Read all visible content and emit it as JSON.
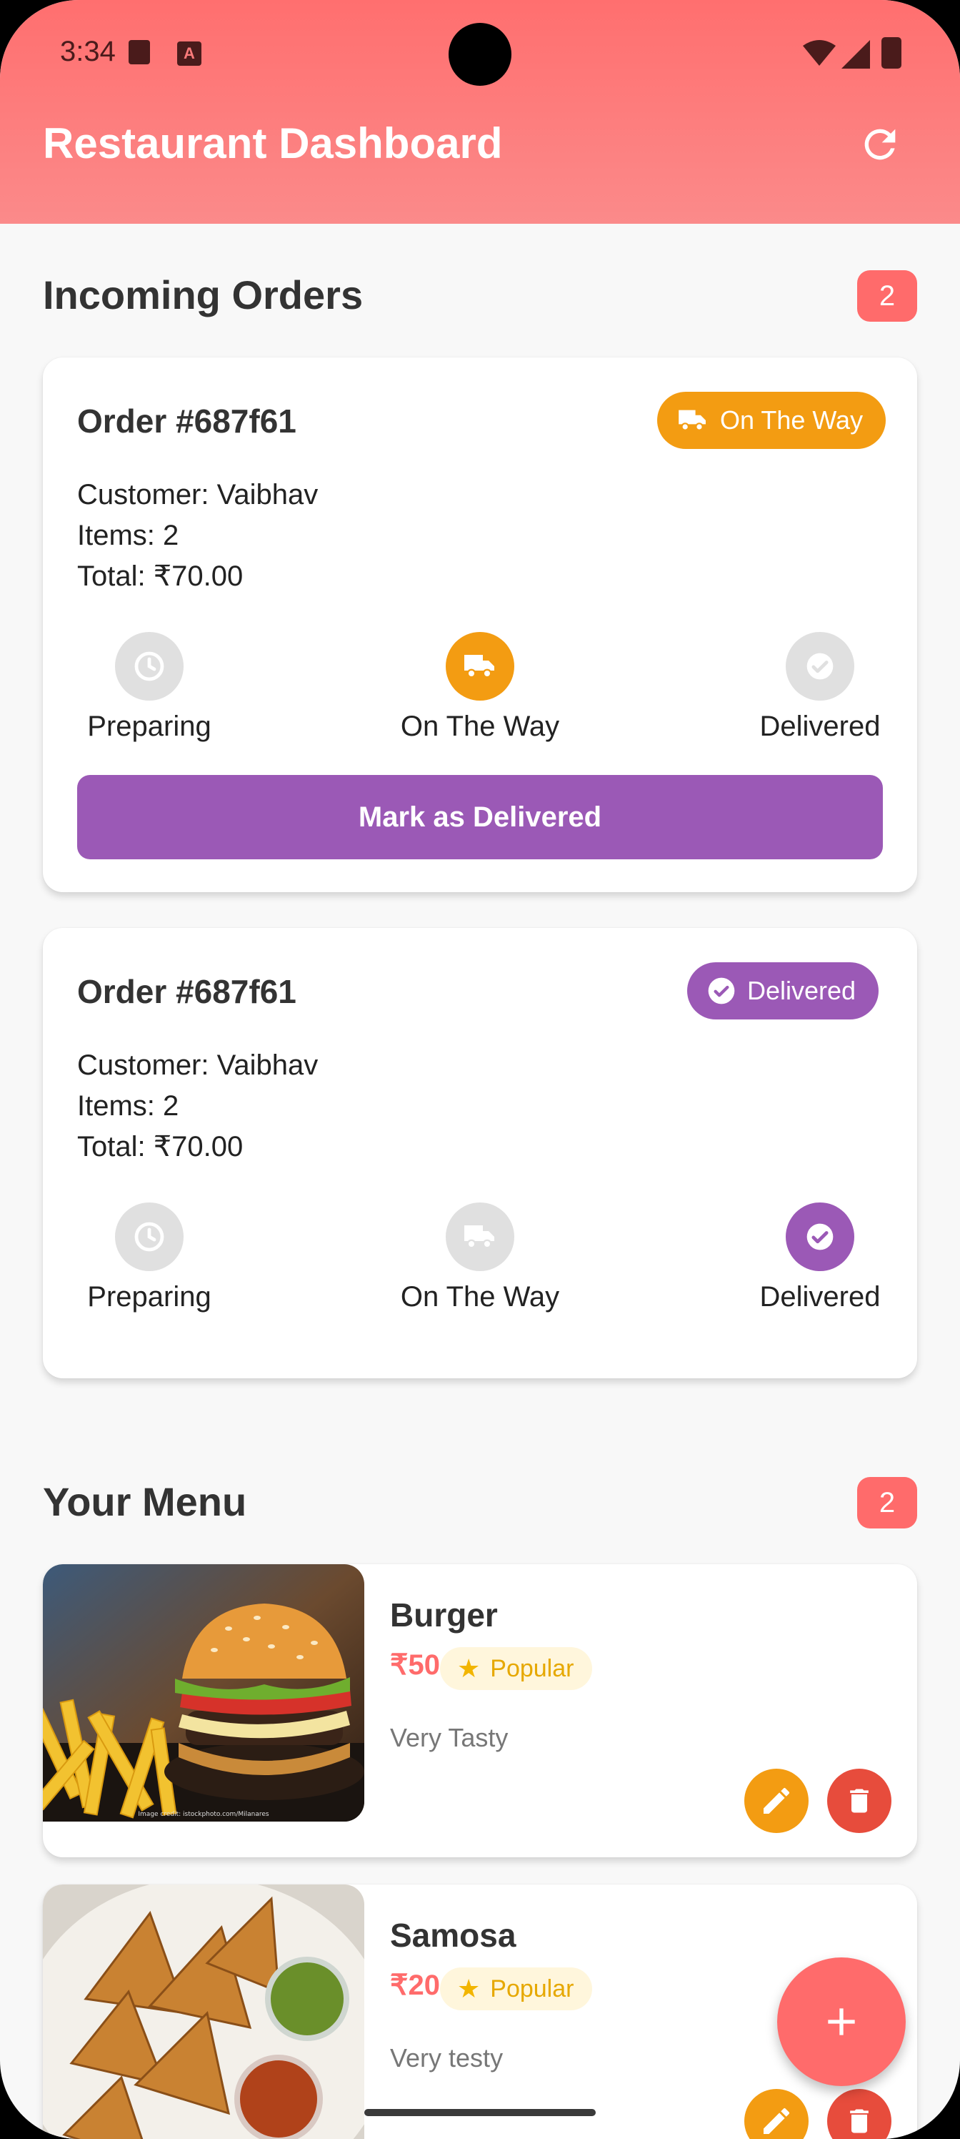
{
  "status_bar": {
    "time": "3:34"
  },
  "app_bar": {
    "title": "Restaurant Dashboard",
    "refresh_icon": "refresh-icon"
  },
  "orders": {
    "title": "Incoming Orders",
    "count": "2",
    "steps": [
      "Preparing",
      "On The Way",
      "Delivered"
    ],
    "items": [
      {
        "id": "Order #687f61",
        "status": "On The Way",
        "customer": "Customer: Vaibhav",
        "items": "Items: 2",
        "total": "Total: ₹70.00",
        "action": "Mark as Delivered",
        "status_color": "#f39c12"
      },
      {
        "id": "Order #687f61",
        "status": "Delivered",
        "customer": "Customer: Vaibhav",
        "items": "Items: 2",
        "total": "Total: ₹70.00",
        "status_color": "#9b59b6"
      }
    ]
  },
  "menu": {
    "title": "Your Menu",
    "count": "2",
    "items": [
      {
        "name": "Burger",
        "price": "₹50",
        "tag": "Popular",
        "desc": "Very Tasty",
        "image_credit": "Image credit: istockphoto.com/Milanares"
      },
      {
        "name": "Samosa",
        "price": "₹20",
        "tag": "Popular",
        "desc": "Very testy"
      }
    ]
  },
  "colors": {
    "primary": "#ff6b6b",
    "on_the_way": "#f39c12",
    "delivered": "#9b59b6",
    "inactive": "#e0e0e0"
  },
  "fab": {
    "icon": "plus-icon"
  }
}
